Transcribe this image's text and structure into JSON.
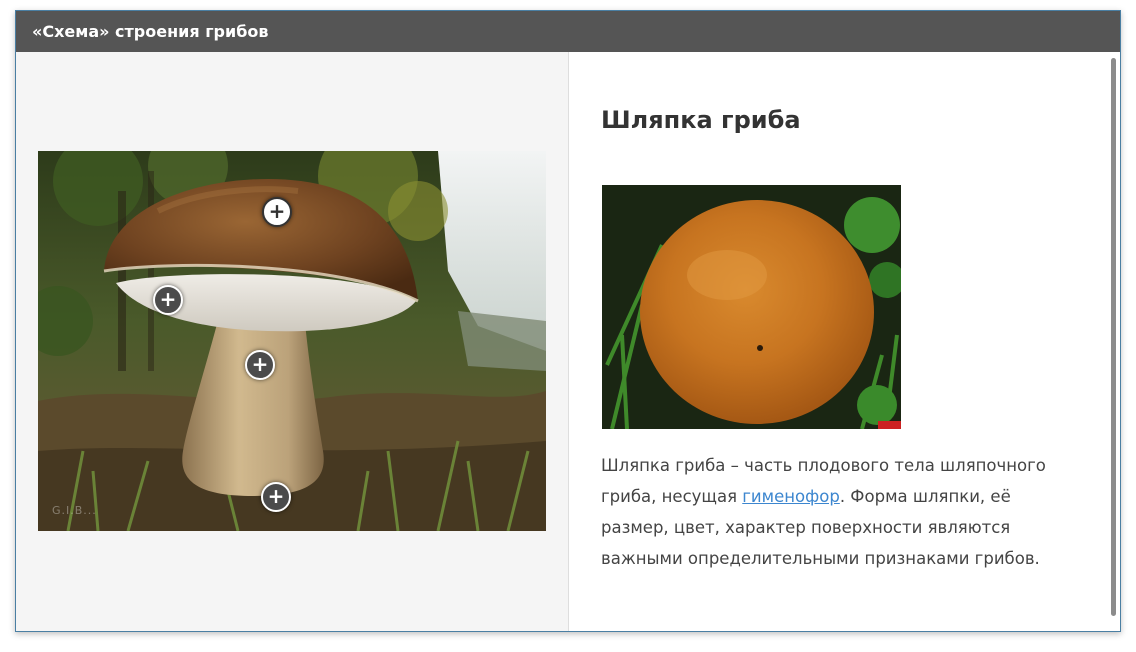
{
  "window": {
    "title": "«Схема» строения грибов"
  },
  "main_image": {
    "watermark": "G.I.B...",
    "hotspots": [
      {
        "name": "cap",
        "symbol": "+"
      },
      {
        "name": "hymenophore",
        "symbol": "+"
      },
      {
        "name": "stem",
        "symbol": "+"
      },
      {
        "name": "mycelium",
        "symbol": "+"
      }
    ]
  },
  "detail": {
    "heading": "Шляпка гриба",
    "text_before": "Шляпка гриба – часть плодового тела шляпочного гриба, несущая ",
    "link": "гименофор",
    "text_after": ". Форма шляпки, её размер, цвет, характер поверхности являются важными определительными признаками грибов."
  },
  "colors": {
    "titlebar": "#555555",
    "link": "#3c86cf",
    "border": "#4a7fa3"
  }
}
